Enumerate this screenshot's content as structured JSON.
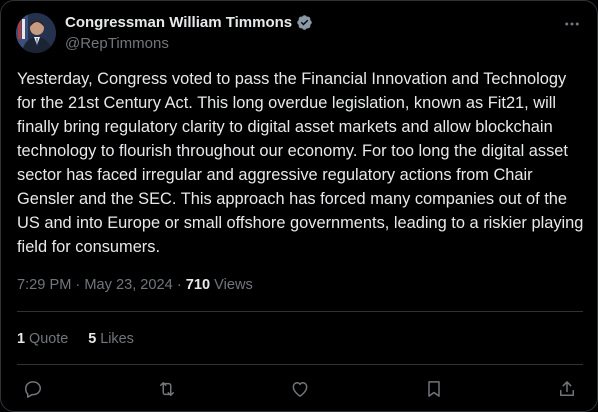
{
  "author": {
    "name": "Congressman William Timmons",
    "handle": "@RepTimmons",
    "verified_icon": "verified-badge-icon",
    "verified_color": "#8b98a5"
  },
  "tweet": {
    "text": "Yesterday, Congress voted to pass the Financial Innovation and Technology for the 21st Century Act. This long overdue legislation, known as Fit21, will finally bring regulatory clarity to digital asset markets and allow blockchain technology to flourish throughout our economy. For too long the digital asset sector has faced irregular and aggressive regulatory actions from Chair Gensler and the SEC. This approach has forced many companies out of the US and into Europe or small offshore governments, leading to a riskier playing field for consumers."
  },
  "meta": {
    "time": "7:29 PM",
    "separator1": " · ",
    "date": "May 23, 2024",
    "separator2": " · ",
    "views_count": "710",
    "views_label": " Views"
  },
  "stats": {
    "quotes_count": "1",
    "quotes_label": " Quote",
    "likes_count": "5",
    "likes_label": " Likes"
  },
  "actions": {
    "reply_icon": "reply-icon",
    "retweet_icon": "retweet-icon",
    "like_icon": "heart-icon",
    "bookmark_icon": "bookmark-icon",
    "share_icon": "share-icon"
  },
  "colors": {
    "background": "#000000",
    "text_primary": "#e7e9ea",
    "text_secondary": "#71767b",
    "border": "#2f3336"
  }
}
